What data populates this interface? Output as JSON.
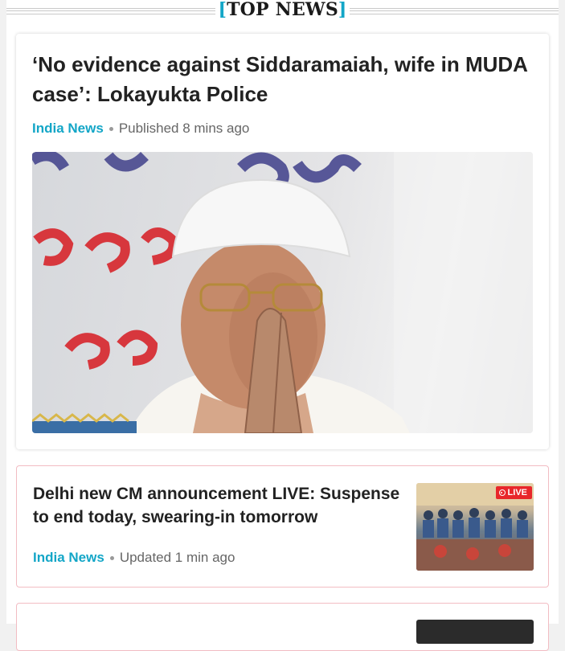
{
  "section": {
    "bracket_open": "[",
    "title": "TOP NEWS",
    "bracket_close": "]"
  },
  "top_story": {
    "headline": "‘No evidence against Siddaramaiah, wife in MUDA case’: Lokayukta Police",
    "category": "India News",
    "timestamp": "Published 8 mins ago",
    "image_icon": "photo-siddaramaiah-icon"
  },
  "second_story": {
    "headline": "Delhi new CM announcement LIVE: Suspense to end today, swearing-in tomorrow",
    "category": "India News",
    "timestamp": "Updated 1 min ago",
    "live_label": "LIVE"
  },
  "colors": {
    "accent": "#13a6c7",
    "live_red": "#e8262a",
    "card_border": "#f2bcc3"
  }
}
